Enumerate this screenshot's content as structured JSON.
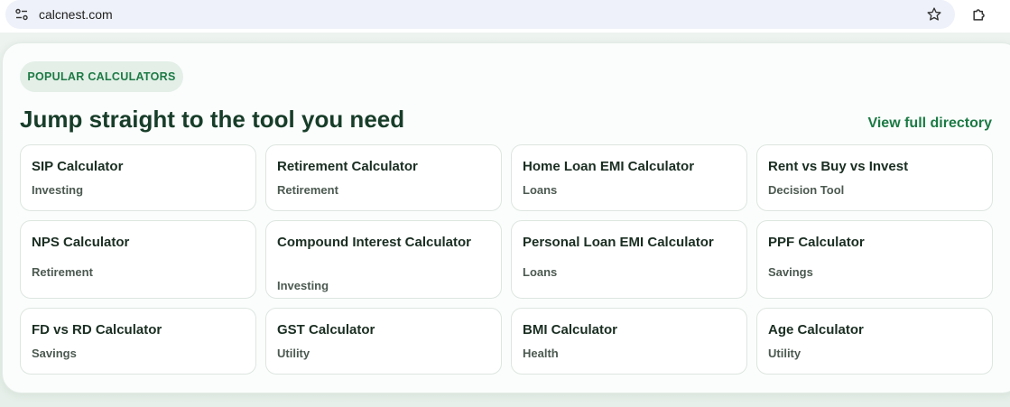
{
  "browser": {
    "url": "calcnest.com",
    "site_info_icon": "tune-icon",
    "bookmark_icon": "star-icon",
    "extensions_icon": "puzzle-icon"
  },
  "section": {
    "badge": "POPULAR CALCULATORS",
    "heading": "Jump straight to the tool you need",
    "directory_link": "View full directory"
  },
  "colors": {
    "accent_green": "#1b7a44",
    "heading_dark": "#173d29",
    "badge_bg": "#e3efe7"
  },
  "calculators": [
    {
      "title": "SIP Calculator",
      "category": "Investing"
    },
    {
      "title": "Retirement Calculator",
      "category": "Retirement"
    },
    {
      "title": "Home Loan EMI Calculator",
      "category": "Loans"
    },
    {
      "title": "Rent vs Buy vs Invest",
      "category": "Decision Tool"
    },
    {
      "title": "NPS Calculator",
      "category": "Retirement"
    },
    {
      "title": "Compound Interest Calculator",
      "category": "Investing"
    },
    {
      "title": "Personal Loan EMI Calculator",
      "category": "Loans"
    },
    {
      "title": "PPF Calculator",
      "category": "Savings"
    },
    {
      "title": "FD vs RD Calculator",
      "category": "Savings"
    },
    {
      "title": "GST Calculator",
      "category": "Utility"
    },
    {
      "title": "BMI Calculator",
      "category": "Health"
    },
    {
      "title": "Age Calculator",
      "category": "Utility"
    }
  ]
}
